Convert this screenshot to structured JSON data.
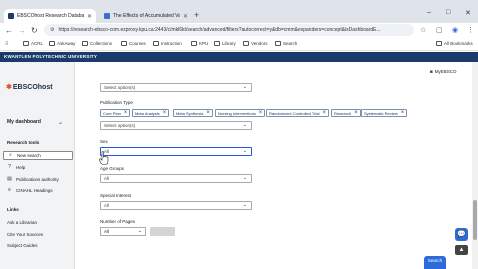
{
  "browser": {
    "tabs": [
      {
        "title": "EBSCOhost Research Databases",
        "active": true
      },
      {
        "title": "The Effects of Accumulated Va",
        "active": false
      }
    ],
    "new_tab_symbol": "+",
    "window_controls": {
      "minimize": "–",
      "maximize": "□",
      "close": "✕"
    },
    "url": "https://research-ebsco-com.ezproxy.kpu.ca:2443/c/mkl6kt/search/advanced/filters?autocorrect=y&db=cmm&expanders=concept&isDashboardE...",
    "bookmarks": [
      "ACRL",
      "AskAway",
      "Collections",
      "Courses",
      "Instruction",
      "KPU",
      "Library",
      "Vendors",
      "Search"
    ],
    "all_bookmarks": "All Bookmarks"
  },
  "banner": "KWANTLEN POLYTECHNIC UNIVERSITY",
  "header": {
    "logo": "EBSCOhost",
    "account_label": "MyEBSCO"
  },
  "sidebar": {
    "dashboard_label": "My dashboard",
    "research_tools_heading": "Research tools",
    "research_tools": [
      "New search",
      "Help",
      "Publications authority",
      "CINAHL Headings"
    ],
    "links_heading": "Links",
    "links": [
      "Ask a Librarian",
      "Cite Your Sources",
      "Subject Guides"
    ]
  },
  "filters": {
    "top_select_placeholder": "Select option(s)",
    "publication_type_label": "Publication Type",
    "publication_type_chips": [
      "Core Plan",
      "Meta Analysis",
      "Meta Synthesis",
      "Nursing Interventions",
      "Randomized Controlled Trial",
      "Research",
      "Systematic Review"
    ],
    "publication_type_placeholder": "Select option(s)",
    "sex_label": "Sex",
    "sex_value": "All",
    "age_groups_label": "Age Groups",
    "age_groups_value": "All",
    "special_interest_label": "Special Interest",
    "special_interest_value": "All",
    "pages_label": "Number of Pages",
    "pages_value": "All"
  },
  "search_button": "Search",
  "colors": {
    "banner": "#1a3b6b",
    "accent": "#2d6bd9",
    "logo_star": "#e34b33"
  }
}
